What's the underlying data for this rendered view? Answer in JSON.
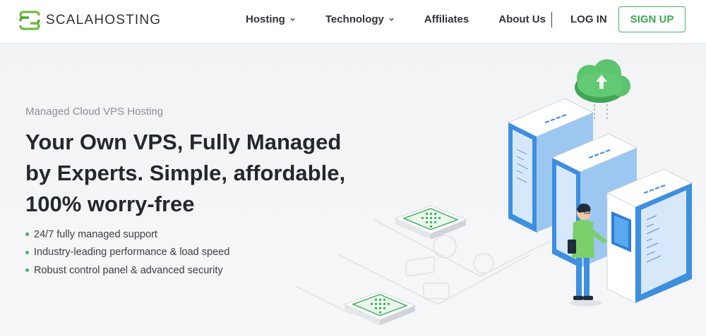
{
  "brand": {
    "name": "SCALAHOSTING",
    "color": "#4db162"
  },
  "nav": {
    "items": [
      {
        "label": "Hosting",
        "has_dropdown": true
      },
      {
        "label": "Technology",
        "has_dropdown": true
      },
      {
        "label": "Affiliates",
        "has_dropdown": false
      },
      {
        "label": "About Us",
        "has_dropdown": false
      }
    ],
    "login_label": "LOG IN",
    "signup_label": "SIGN UP"
  },
  "hero": {
    "eyebrow": "Managed Cloud VPS Hosting",
    "headline": "Your Own VPS, Fully Managed by Experts. Simple, affordable, 100% worry-free",
    "bullets": [
      "24/7 fully managed support",
      "Industry-leading performance & load speed",
      "Robust control panel & advanced security"
    ]
  },
  "colors": {
    "accent": "#4db162",
    "server_blue": "#3d8fe0",
    "server_light": "#e9f2fc"
  }
}
